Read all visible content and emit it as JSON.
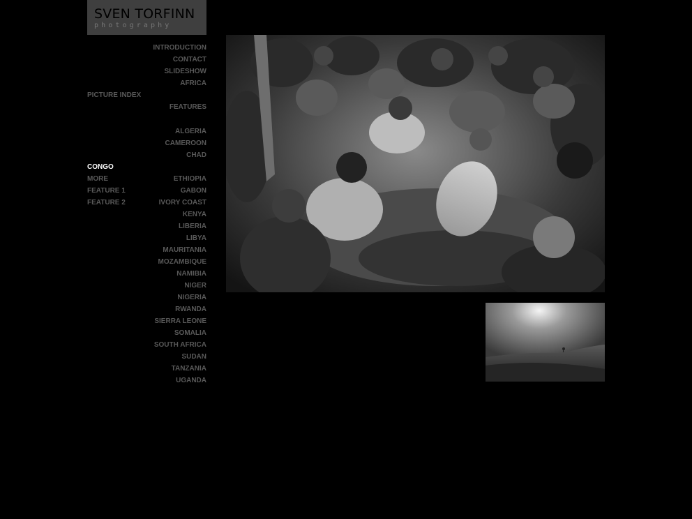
{
  "logo": {
    "title": "SVEN TORFINN",
    "subtitle": "photography"
  },
  "nav": {
    "top": [
      "INTRODUCTION",
      "CONTACT",
      "SLIDESHOW",
      "AFRICA"
    ],
    "picture_index": "PICTURE INDEX",
    "features": "FEATURES",
    "countries_a": [
      "ALGERIA",
      "CAMEROON",
      "CHAD"
    ],
    "congo": "CONGO",
    "congo_sub": [
      "MORE",
      "FEATURE 1",
      "FEATURE 2"
    ],
    "countries_b": [
      "ETHIOPIA",
      "GABON",
      "IVORY COAST",
      "KENYA",
      "LIBERIA",
      "LIBYA",
      "MAURITANIA",
      "MOZAMBIQUE",
      "NAMIBIA",
      "NIGER",
      "NIGERIA",
      "RWANDA",
      "SIERRA LEONE",
      "SOMALIA",
      "SOUTH AFRICA",
      "SUDAN",
      "TANZANIA",
      "UGANDA"
    ]
  },
  "colors": {
    "background": "#000000",
    "nav_text": "#595959",
    "nav_active": "#ffffff",
    "logo_bg": "#3f3f3f"
  }
}
